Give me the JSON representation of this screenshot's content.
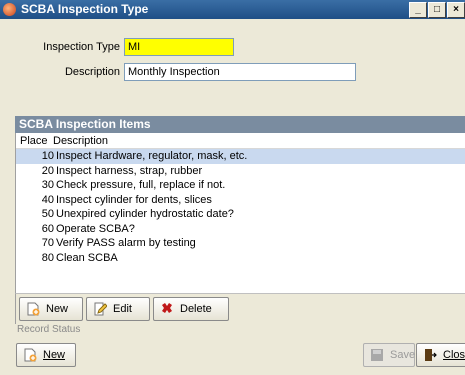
{
  "window": {
    "title": "SCBA Inspection Type",
    "min_glyph": "_",
    "max_glyph": "□",
    "close_glyph": "×"
  },
  "form": {
    "type_label": "Inspection Type",
    "type_value": "MI",
    "desc_label": "Description",
    "desc_value": "Monthly Inspection"
  },
  "items": {
    "header": "SCBA Inspection Items",
    "col_place": "Place",
    "col_desc": "Description",
    "rows": [
      {
        "place": "10",
        "desc": "Inspect Hardware, regulator, mask, etc."
      },
      {
        "place": "20",
        "desc": "Inspect harness, strap, rubber"
      },
      {
        "place": "30",
        "desc": "Check pressure, full, replace if not."
      },
      {
        "place": "40",
        "desc": "Inspect cylinder for dents, slices"
      },
      {
        "place": "50",
        "desc": "Unexpired cylinder hydrostatic date?"
      },
      {
        "place": "60",
        "desc": "Operate SCBA?"
      },
      {
        "place": "70",
        "desc": "Verify PASS alarm by testing"
      },
      {
        "place": "80",
        "desc": "Clean SCBA"
      }
    ],
    "selected_index": 0
  },
  "buttons": {
    "new": "New",
    "edit": "Edit",
    "delete": "Delete"
  },
  "status": {
    "label": "Record Status"
  },
  "bottom": {
    "new": "New",
    "save": "Save",
    "close": "Close"
  },
  "colors": {
    "title_bg": "#1f4f86",
    "selected_row": "#c9d9ef",
    "type_field": "#ffff00",
    "section_header": "#7a8ca0"
  }
}
